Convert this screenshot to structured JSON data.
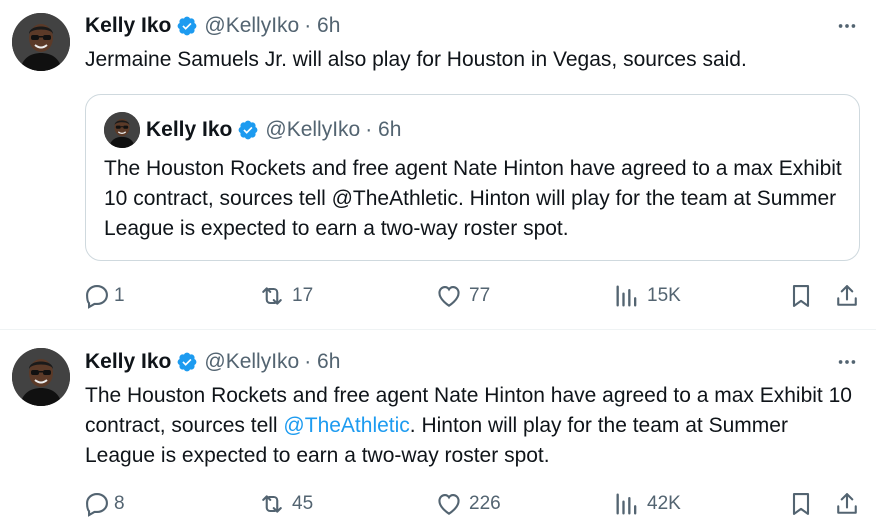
{
  "tweets": [
    {
      "author": {
        "name": "Kelly Iko",
        "handle": "@KellyIko",
        "time": "· 6h"
      },
      "text": "Jermaine Samuels Jr. will also play for Houston in Vegas, sources said.",
      "quoted": {
        "author": {
          "name": "Kelly Iko",
          "handle": "@KellyIko",
          "time": "· 6h"
        },
        "text": "The Houston Rockets and free agent Nate Hinton have agreed to a max Exhibit 10 contract, sources tell @TheAthletic. Hinton will play for the team at Summer League is expected to earn a two-way roster spot."
      },
      "stats": {
        "replies": "1",
        "reposts": "17",
        "likes": "77",
        "views": "15K"
      }
    },
    {
      "author": {
        "name": "Kelly Iko",
        "handle": "@KellyIko",
        "time": "· 6h"
      },
      "text_before": "The Houston Rockets and free agent Nate Hinton have agreed to a max Exhibit 10 contract, sources tell ",
      "mention": "@TheAthletic",
      "text_after": ". Hinton will play for the team at Summer League is expected to earn a two-way roster spot.",
      "stats": {
        "replies": "8",
        "reposts": "45",
        "likes": "226",
        "views": "42K"
      }
    }
  ],
  "icons": {
    "verified": "verified-badge-icon",
    "more": "more-icon",
    "reply": "reply-icon",
    "repost": "repost-icon",
    "like": "like-icon",
    "views": "views-icon",
    "bookmark": "bookmark-icon",
    "share": "share-icon"
  },
  "colors": {
    "accent": "#1d9bf0",
    "muted": "#536471",
    "text": "#0f1419",
    "border": "#cfd9de"
  }
}
